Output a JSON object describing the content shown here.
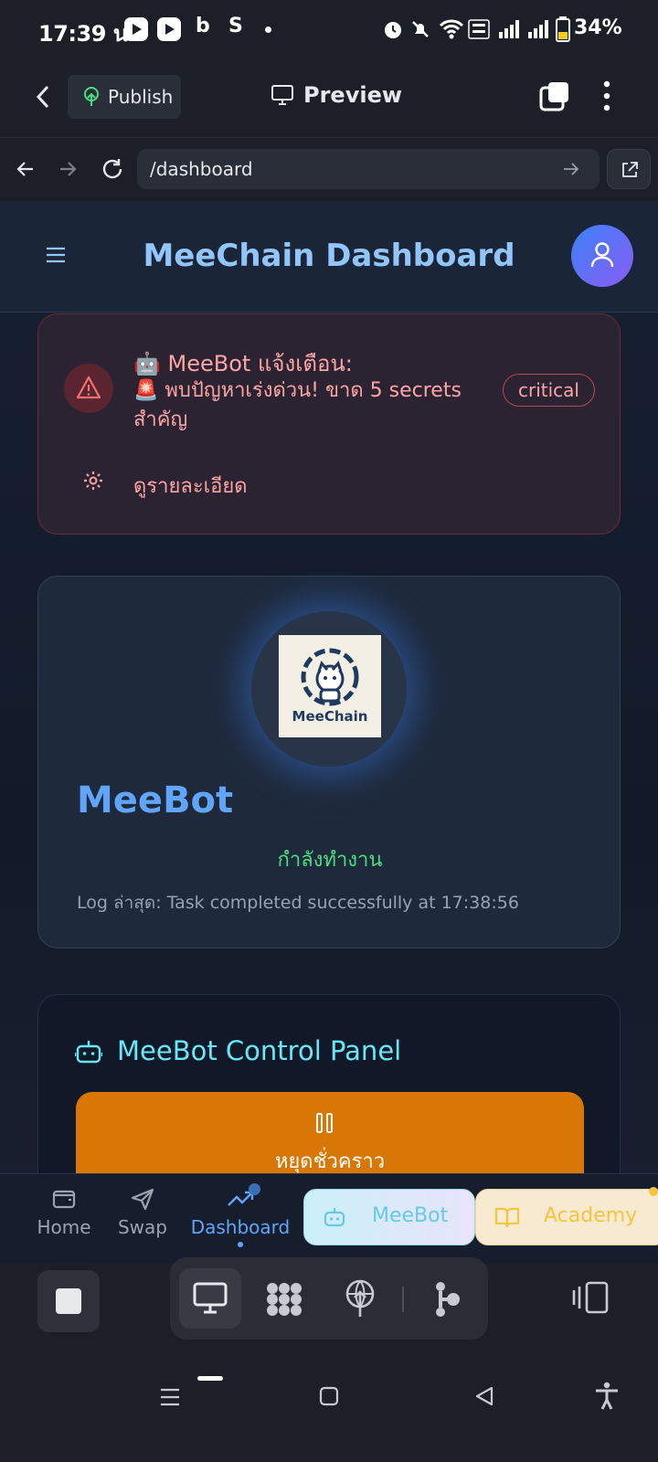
{
  "status_bar": {
    "time": "17:39 น.",
    "battery": "34%",
    "glyph_b": "b",
    "glyph_s": "S"
  },
  "app_bar": {
    "publish_label": "Publish",
    "preview_label": "Preview"
  },
  "browser": {
    "url": "/dashboard"
  },
  "page": {
    "title": "MeeChain Dashboard",
    "alert": {
      "title": "🤖 MeeBot แจ้งเตือน:",
      "message": "🚨 พบปัญหาเร่งด่วน! ขาด 5 secrets สำคัญ",
      "badge": "critical",
      "details_label": "ดูรายละเอียด"
    },
    "bot": {
      "logo_text": "MeeChain",
      "name": "MeeBot",
      "status": "กำลังทำงาน",
      "log": "Log ล่าสุด: Task completed successfully at 17:38:56"
    },
    "control_panel": {
      "title": "MeeBot Control Panel",
      "pause_label": "หยุดชั่วคราว"
    },
    "nav": {
      "home": "Home",
      "swap": "Swap",
      "dashboard": "Dashboard",
      "meebot": "MeeBot",
      "academy": "Academy"
    }
  },
  "colors": {
    "accent_blue": "#60a5fa",
    "alert_red": "#fca5a5",
    "status_green": "#4ade80",
    "pause_orange": "#d97706",
    "cyan": "#67e8f9"
  }
}
